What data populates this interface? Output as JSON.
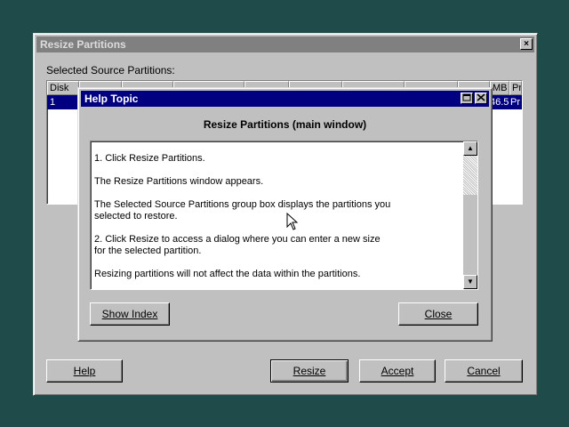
{
  "main_window": {
    "title": "Resize Partitions",
    "close_glyph": "×",
    "selected_label": "Selected Source Partitions:",
    "columns": [
      "Disk",
      "",
      "",
      "",
      "",
      "",
      "",
      "",
      "",
      "MB",
      "Pr"
    ],
    "row": {
      "disk": "1",
      "mb": "46.5",
      "pr": "Pr"
    },
    "buttons": {
      "help": "Help",
      "resize": "Resize",
      "accept": "Accept",
      "cancel": "Cancel"
    }
  },
  "help_dialog": {
    "title": "Help Topic",
    "heading": "Resize Partitions (main window)",
    "lines": [
      "1. Click Resize Partitions.",
      "The Resize Partitions window appears.",
      "The Selected Source Partitions group box displays the partitions you",
      "selected to restore.",
      "2. Click Resize to access a dialog where you can enter a new size",
      "for the selected partition.",
      "Resizing partitions will not affect the data within the partitions."
    ],
    "buttons": {
      "show_index": "Show Index",
      "close": "Close"
    }
  }
}
